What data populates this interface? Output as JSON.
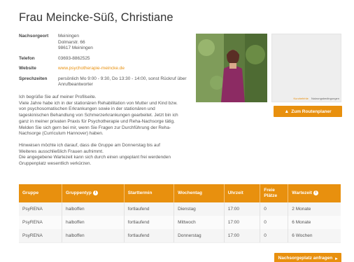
{
  "profile": {
    "name": "Frau Meincke-Süß, Christiane",
    "labels": {
      "address": "Nachsorgeort",
      "phone": "Telefon",
      "website": "Website",
      "hours": "Sprechzeiten"
    },
    "address_lines": [
      "Meiningen",
      "Dolmarstr. 66",
      "98617 Meiningen"
    ],
    "phone": "03693-8862525",
    "website": "www.psychotherapie-meincke.de",
    "hours": "persönlich Mo 9:00 - 9:30, Do 13:30 - 14:00, sonst Rückruf über Anrufbeantworter",
    "paragraphs": [
      "Ich begrüße Sie auf meiner Profilseite.\nViele Jahre habe ich in der stationären Rehabilitation von Mutter und Kind bzw. von psychosomatischen Erkrankungen sowie in der stationären und tageskinischen Behandlung von Schmerzerkrankungen gearbeitet. Jetzt bin ich ganz in meiner privaten Praxis für Psychotherapie und Reha-Nachsorge tätig. Melden Sie sich gern bei mir, wenn Sie Fragen zur Durchführung der Reha-Nachsorge (Curriculum Hannover) haben.",
      "Hinweisen möchte ich darauf, dass die Gruppe am Donnerstag bis auf Weiteres ausschließlich Frauen aufnimmt.\nDie angegebene Wartezeit kann sich durch einen ungeplant frei werdenden Gruppenplatz wesentlich verkürzen."
    ]
  },
  "map": {
    "link_keyboard": "Kurzbefehle",
    "link_terms": "Nutzungsbedingungen"
  },
  "buttons": {
    "route": "Zum Routenplaner",
    "request": "Nachsorgeplatz anfragen"
  },
  "table": {
    "headers": [
      "Gruppe",
      "Gruppentyp",
      "Starttermin",
      "Wochentag",
      "Uhrzeit",
      "Freie Plätze",
      "Wartezeit"
    ],
    "rows": [
      [
        "PsyRENA",
        "halboffen",
        "fortlaufend",
        "Dienstag",
        "17:00",
        "0",
        "2 Monate"
      ],
      [
        "PsyRENA",
        "halboffen",
        "fortlaufend",
        "Mittwoch",
        "17:00",
        "0",
        "6 Monate"
      ],
      [
        "PsyRENA",
        "halboffen",
        "fortlaufend",
        "Donnerstag",
        "17:00",
        "0",
        "6 Wochen"
      ]
    ]
  },
  "colors": {
    "accent": "#e8900e",
    "text": "#555555"
  }
}
